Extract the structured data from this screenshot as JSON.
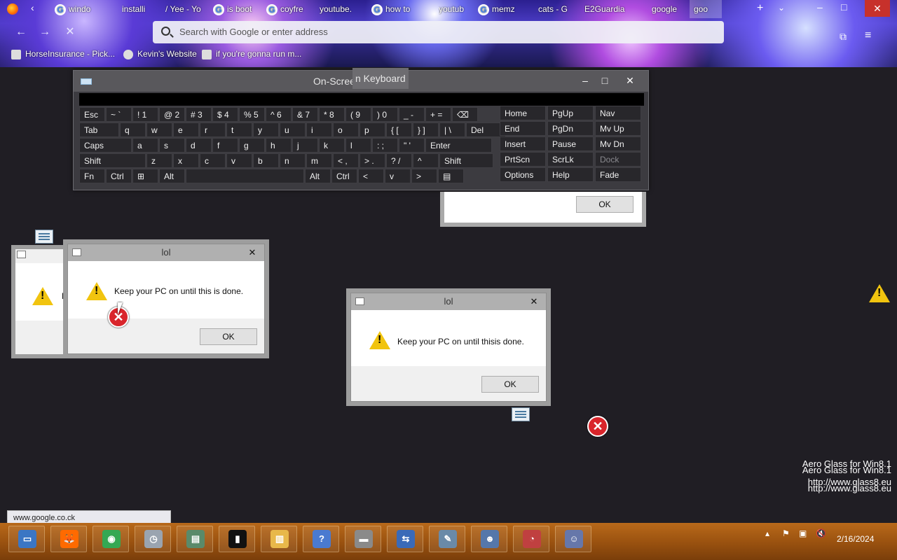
{
  "browser": {
    "tabs": [
      {
        "label": "windo",
        "icon": "google-icon"
      },
      {
        "label": "installi",
        "icon": "generic-icon"
      },
      {
        "label": "Yee - Yo",
        "icon": "youtube-icon"
      },
      {
        "label": "is boot",
        "icon": "google-icon"
      },
      {
        "label": "coyfre",
        "icon": "google-icon"
      },
      {
        "label": "youtube.",
        "icon": "generic-icon"
      },
      {
        "label": "how to",
        "icon": "google-icon"
      },
      {
        "label": "youtub",
        "icon": "generic-icon"
      },
      {
        "label": "memz",
        "icon": "google-icon"
      },
      {
        "label": "cats - G",
        "icon": "generic-icon"
      },
      {
        "label": "E2Guardia",
        "icon": "generic-icon"
      },
      {
        "label": "google",
        "icon": "generic-icon"
      },
      {
        "label": "goo",
        "icon": "generic-icon"
      }
    ],
    "address_placeholder": "Search with Google or enter address",
    "bookmarks": [
      {
        "label": "HorseInsurance - Pick..."
      },
      {
        "label": "Kevin's Website"
      },
      {
        "label": "if you're gonna run m..."
      }
    ],
    "status_url": "www.google.co.ck"
  },
  "osk": {
    "title": "On-Screen Keyboard",
    "title_ghost": "n Keyboard",
    "rows": [
      [
        "Esc",
        "~ `",
        "! 1",
        "@ 2",
        "# 3",
        "$ 4",
        "% 5",
        "^ 6",
        "& 7",
        "* 8",
        "( 9",
        ") 0",
        "_ -",
        "+ =",
        "⌫"
      ],
      [
        "Tab",
        "q",
        "w",
        "e",
        "r",
        "t",
        "y",
        "u",
        "i",
        "o",
        "p",
        "{ [",
        "} ]",
        "| \\",
        "Del"
      ],
      [
        "Caps",
        "a",
        "s",
        "d",
        "f",
        "g",
        "h",
        "j",
        "k",
        "l",
        ": ;",
        "\" '",
        "Enter"
      ],
      [
        "Shift",
        "z",
        "x",
        "c",
        "v",
        "b",
        "n",
        "m",
        "< ,",
        "> .",
        "? /",
        "^",
        "Shift"
      ],
      [
        "Fn",
        "Ctrl",
        "⊞",
        "Alt",
        "",
        "Alt",
        "Ctrl",
        "<",
        "v",
        ">",
        "▤"
      ]
    ],
    "nav_keys": [
      [
        "Home",
        "PgUp",
        "Nav"
      ],
      [
        "End",
        "PgDn",
        "Mv Up"
      ],
      [
        "Insert",
        "Pause",
        "Mv Dn"
      ],
      [
        "PrtScn",
        "ScrLk",
        "Dock"
      ],
      [
        "Options",
        "Help",
        "Fade"
      ]
    ],
    "behind_ok": "OK"
  },
  "dialogs": [
    {
      "title": "lol",
      "message": "Keep your PC on until this is done.",
      "ok": "OK"
    },
    {
      "title": "lol",
      "message": "Keep your PC on until thisis done.",
      "ok": "OK"
    }
  ],
  "partial_dialog_text": "K",
  "watermark": {
    "line1": "Aero Glass for Win8.1",
    "line2": "Aero Glass for Win8.1",
    "line3": "http://www.glass8.eu",
    "line4": "http://www.glass8.eu"
  },
  "taskbar": {
    "items": [
      {
        "icon": "start-icon"
      },
      {
        "icon": "firefox-icon"
      },
      {
        "icon": "chrome-icon"
      },
      {
        "icon": "clock-app-icon"
      },
      {
        "icon": "window-app-icon"
      },
      {
        "icon": "terminal-icon"
      },
      {
        "icon": "folder-icon"
      },
      {
        "icon": "help-icon"
      },
      {
        "icon": "drive-icon"
      },
      {
        "icon": "network-icon"
      },
      {
        "icon": "notepad-icon"
      },
      {
        "icon": "user-icon"
      },
      {
        "icon": "timer-icon"
      },
      {
        "icon": "users-icon"
      }
    ],
    "date": "2/16/2024"
  }
}
